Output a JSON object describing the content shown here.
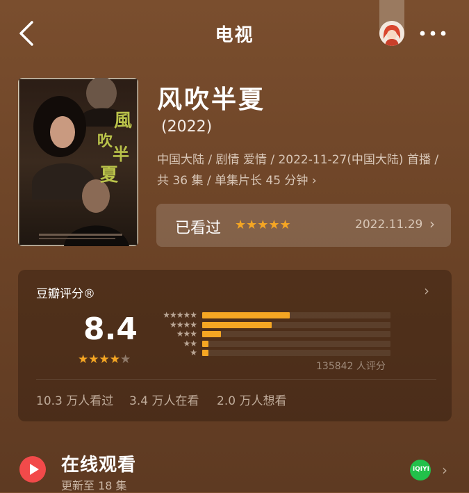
{
  "header": {
    "title": "电视"
  },
  "subject": {
    "title": "风吹半夏",
    "year": "(2022)",
    "meta": "中国大陆 / 剧情 爱情 / 2022-11-27(中国大陆) 首播 / 共 36 集 / 单集片长 45 分钟",
    "poster_text": "風吹半夏"
  },
  "my_status": {
    "label": "已看过",
    "stars": "★★★★★",
    "date": "2022.11.29"
  },
  "rating": {
    "title": "豆瓣评分®",
    "score": "8.4",
    "stars_on": "★★★★",
    "stars_off": "★",
    "distribution": [
      {
        "stars": "★★★★★",
        "percent": 46.5
      },
      {
        "stars": "★★★★",
        "percent": 37.0
      },
      {
        "stars": "★★★",
        "percent": 10.0
      },
      {
        "stars": "★★",
        "percent": 3.5
      },
      {
        "stars": "★",
        "percent": 3.5
      }
    ],
    "votes": "135842 人评分",
    "watched": "10.3 万人看过",
    "watching": "3.4 万人在看",
    "wish": "2.0 万人想看"
  },
  "online": {
    "title": "在线观看",
    "subtitle": "更新至 18 集",
    "provider_icon": "iqiyi-icon",
    "provider_label": "iQIYI"
  },
  "colors": {
    "accent": "#f5a623",
    "play": "#f24a4a",
    "iqiyi": "#22c04a"
  }
}
